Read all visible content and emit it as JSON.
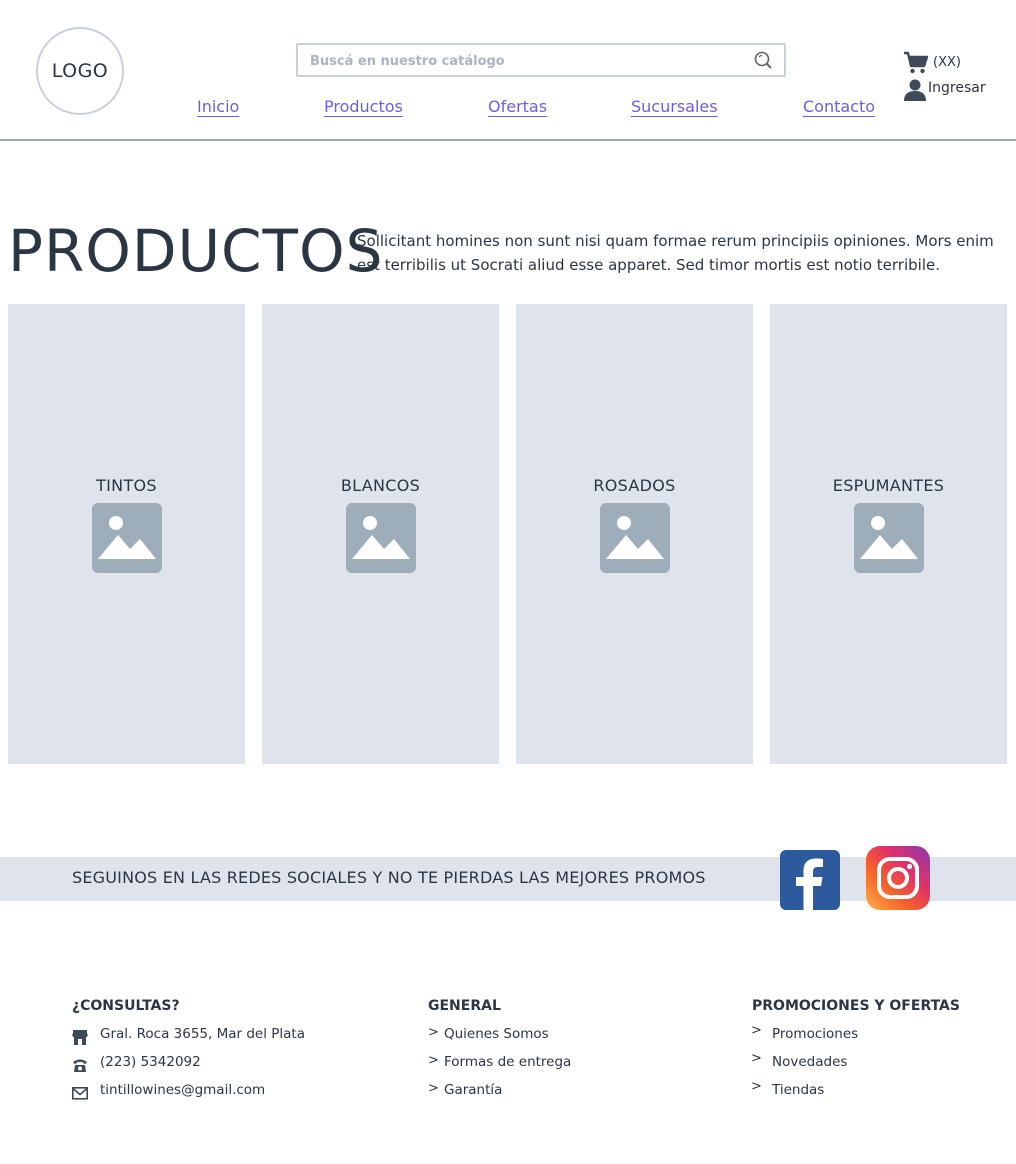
{
  "header": {
    "logo_text": "LOGO",
    "search_placeholder": "Buscá en nuestro catálogo",
    "nav": [
      "Inicio",
      "Productos",
      "Ofertas",
      "Sucursales",
      "Contacto"
    ],
    "cart_count": "(XX)",
    "login_label": "Ingresar"
  },
  "intro": {
    "title": "PRODUCTOS",
    "description": "Sollicitant homines non sunt nisi quam formae rerum principiis opiniones. Mors enim est terribilis ut Socrati aliud esse apparet. Sed timor mortis est notio terribile."
  },
  "categories": [
    "TINTOS",
    "BLANCOS",
    "ROSADOS",
    "ESPUMANTES"
  ],
  "social": {
    "text": "SEGUINOS EN LAS REDES SOCIALES Y NO TE PIERDAS LAS MEJORES PROMOS",
    "icons": [
      "facebook-icon",
      "instagram-icon"
    ]
  },
  "footer": {
    "contact": {
      "heading": "¿CONSULTAS?",
      "address": "Gral. Roca 3655, Mar del Plata",
      "phone": "(223) 5342092",
      "email": "tintillowines@gmail.com"
    },
    "general": {
      "heading": "GENERAL",
      "items": [
        "Quienes Somos",
        "Formas de entrega",
        "Garantía"
      ]
    },
    "promos": {
      "heading": "PROMOCIONES Y OFERTAS",
      "items": [
        "Promociones",
        "Novedades",
        "Tiendas"
      ]
    },
    "chevron": ">"
  },
  "colors": {
    "text": "#2a3644",
    "link": "#6b5fe0",
    "card_bg": "#dfe4ec",
    "placeholder_icon": "#9eadba",
    "facebook": "#2c5a9c"
  }
}
